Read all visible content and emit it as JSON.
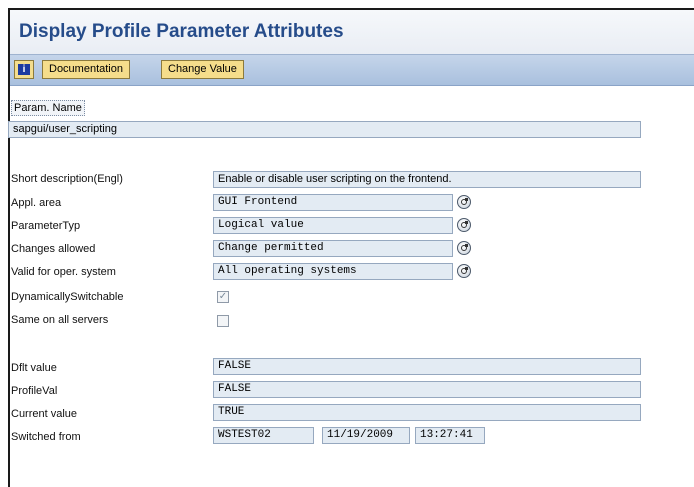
{
  "window": {
    "title": "Display Profile Parameter Attributes"
  },
  "toolbar": {
    "info_glyph": "i",
    "documentation_label": "Documentation",
    "change_value_label": "Change Value"
  },
  "param": {
    "name_label": "Param. Name",
    "name_value": "sapgui/user_scripting"
  },
  "attributes": {
    "short_description": {
      "label": "Short description(Engl)",
      "value": "Enable or disable user scripting on the frontend."
    },
    "appl_area": {
      "label": "Appl. area",
      "value": "GUI Frontend"
    },
    "parameter_type": {
      "label": "ParameterTyp",
      "value": "Logical value"
    },
    "changes_allowed": {
      "label": "Changes allowed",
      "value": "Change permitted"
    },
    "valid_for_os": {
      "label": "Valid for oper. system",
      "value": "All operating systems"
    },
    "dynamically_switchable": {
      "label": "DynamicallySwitchable",
      "checked": true,
      "mark": "✓"
    },
    "same_on_all_servers": {
      "label": "Same on all servers",
      "checked": false
    }
  },
  "values": {
    "default": {
      "label": "Dflt value",
      "value": "FALSE"
    },
    "profile": {
      "label": "ProfileVal",
      "value": "FALSE"
    },
    "current": {
      "label": "Current value",
      "value": "TRUE"
    },
    "switched_from": {
      "label": "Switched from",
      "user": "WSTEST02",
      "date": "11/19/2009",
      "time": "13:27:41"
    }
  },
  "icons": {
    "value_help": "value-help-icon",
    "info": "info-icon"
  },
  "colors": {
    "title": "#264c8a",
    "toolbar_bg": "#b6c9e3",
    "button_bg": "#f5dd8b",
    "field_bg": "#e3ebf3"
  }
}
